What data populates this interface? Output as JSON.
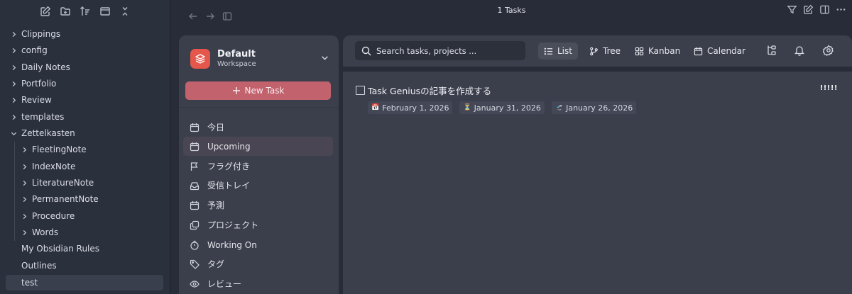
{
  "explorer": {
    "tree": [
      {
        "label": "Clippings",
        "type": "folder",
        "level": 0
      },
      {
        "label": "config",
        "type": "folder",
        "level": 0
      },
      {
        "label": "Daily Notes",
        "type": "folder",
        "level": 0
      },
      {
        "label": "Portfolio",
        "type": "folder",
        "level": 0
      },
      {
        "label": "Review",
        "type": "folder",
        "level": 0
      },
      {
        "label": "templates",
        "type": "folder",
        "level": 0
      },
      {
        "label": "Zettelkasten",
        "type": "folder-open",
        "level": 0
      },
      {
        "label": "FleetingNote",
        "type": "folder",
        "level": 1
      },
      {
        "label": "IndexNote",
        "type": "folder",
        "level": 1
      },
      {
        "label": "LiteratureNote",
        "type": "folder",
        "level": 1
      },
      {
        "label": "PermanentNote",
        "type": "folder",
        "level": 1
      },
      {
        "label": "Procedure",
        "type": "folder",
        "level": 1
      },
      {
        "label": "Words",
        "type": "folder",
        "level": 1
      },
      {
        "label": "My Obsidian Rules",
        "type": "file",
        "level": 0
      },
      {
        "label": "Outlines",
        "type": "file",
        "level": 0
      },
      {
        "label": "test",
        "type": "file",
        "level": 0,
        "active": true
      }
    ]
  },
  "header": {
    "title": "1 Tasks"
  },
  "workspace": {
    "name": "Default",
    "subtitle": "Workspace",
    "new_task_label": "New Task"
  },
  "nav": [
    {
      "label": "今日",
      "icon": "calendar-icon"
    },
    {
      "label": "Upcoming",
      "icon": "calendar-icon",
      "selected": true
    },
    {
      "label": "フラグ付き",
      "icon": "flag-icon"
    },
    {
      "label": "受信トレイ",
      "icon": "inbox-icon"
    },
    {
      "label": "予測",
      "icon": "calendar-icon"
    },
    {
      "label": "プロジェクト",
      "icon": "projects-icon"
    },
    {
      "label": "Working On",
      "icon": "timer-icon"
    },
    {
      "label": "タグ",
      "icon": "tag-icon"
    },
    {
      "label": "レビュー",
      "icon": "eye-icon"
    }
  ],
  "search": {
    "placeholder": "Search tasks, projects ..."
  },
  "views": {
    "list": "List",
    "tree": "Tree",
    "kanban": "Kanban",
    "calendar": "Calendar"
  },
  "task": {
    "title": "Task Geniusの記事を作成する",
    "priority": "!!!!!",
    "due_emoji": "📅",
    "due": "February 1, 2026",
    "scheduled_emoji": "⏳",
    "scheduled": "January 31, 2026",
    "start_emoji": "🛫",
    "start": "January 26, 2026"
  },
  "colors": {
    "accent": "#e4574a",
    "new_task_button": "#c1626d",
    "panel": "#3b3f4c",
    "background": "#282c38"
  }
}
